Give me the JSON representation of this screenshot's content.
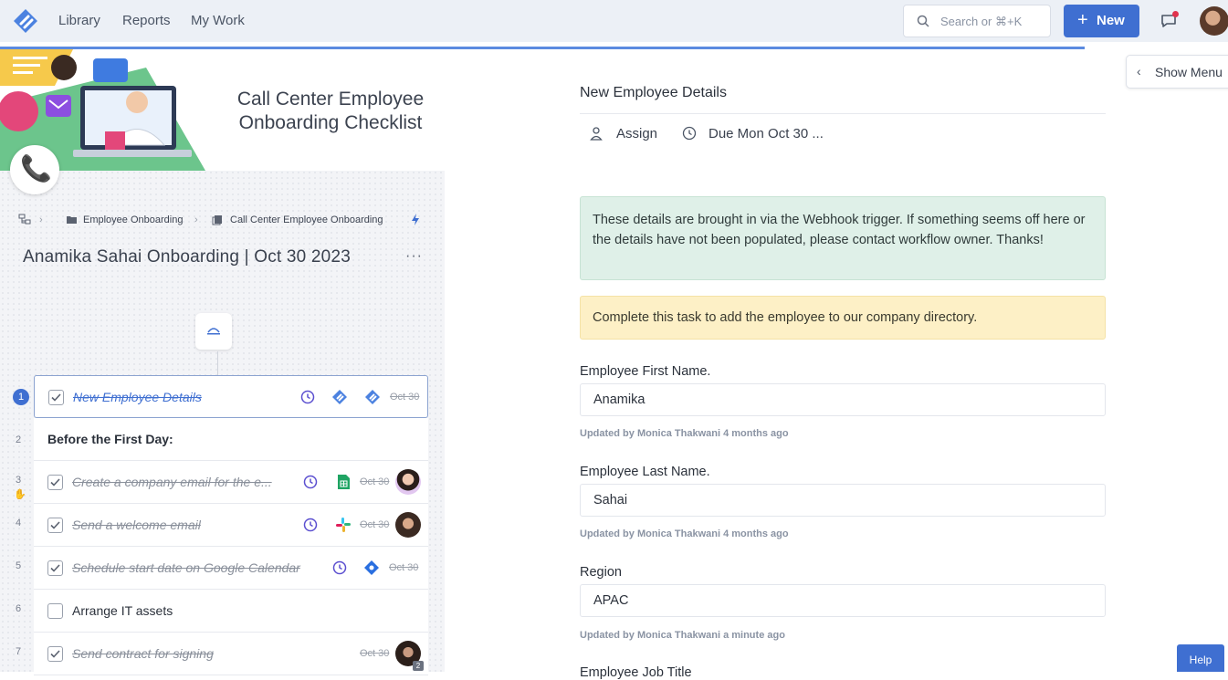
{
  "nav": {
    "links": [
      "Library",
      "Reports",
      "My Work"
    ],
    "search_placeholder": "Search or ⌘+K",
    "new_label": "New"
  },
  "left": {
    "banner_title": "Call Center Employee Onboarding Checklist",
    "breadcrumb": [
      "Employee Onboarding",
      "Call Center Employee Onboarding"
    ],
    "title": "Anamika Sahai Onboarding | Oct 30 2023",
    "more": "···",
    "tasks": [
      {
        "num": "1",
        "label": "New Employee Details",
        "date": "Oct 30",
        "done": true
      },
      {
        "num": "2",
        "label": "Before the First Day:",
        "heading": true
      },
      {
        "num": "3",
        "label": "Create a company email for the e...",
        "date": "Oct 30",
        "done": true
      },
      {
        "num": "4",
        "label": "Send a welcome email",
        "date": "Oct 30",
        "done": true
      },
      {
        "num": "5",
        "label": "Schedule start date on Google Calendar",
        "date": "Oct 30",
        "done": true
      },
      {
        "num": "6",
        "label": "Arrange IT assets",
        "done": false
      },
      {
        "num": "7",
        "label": "Send contract for signing",
        "date": "Oct 30",
        "done": true,
        "badge": "2"
      }
    ]
  },
  "right": {
    "show_menu": "Show Menu",
    "title": "New Employee Details",
    "assign": "Assign",
    "due": "Due Mon Oct 30 ...",
    "note_green": "These details are brought in via the Webhook trigger. If something seems off here or the details have not been populated, please contact workflow owner. Thanks!",
    "note_yellow": "Complete this task to add the employee to our company directory.",
    "fields": [
      {
        "label": "Employee First Name.",
        "value": "Anamika",
        "meta": "Updated by Monica Thakwani 4 months ago"
      },
      {
        "label": "Employee Last Name.",
        "value": "Sahai",
        "meta": "Updated by Monica Thakwani 4 months ago"
      },
      {
        "label": "Region",
        "value": "APAC",
        "meta": "Updated by Monica Thakwani a minute ago"
      },
      {
        "label": "Employee Job Title"
      }
    ]
  },
  "help": "Help",
  "colors": {
    "accent": "#3f6fd1",
    "green_note": "#dff0e8",
    "yellow_note": "#fdf0c6"
  }
}
